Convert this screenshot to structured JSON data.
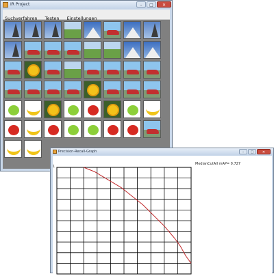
{
  "main_window": {
    "title": "IR Project",
    "controls": {
      "minimize": "–",
      "maximize": "□",
      "close": "✕"
    },
    "menu": [
      "Suchverfahren",
      "Testen",
      "Einstellungen"
    ],
    "thumbnails": [
      "eiffel",
      "eiffel",
      "eiffel",
      "field",
      "mountain",
      "car",
      "mountain",
      "eiffel",
      "eiffel",
      "car",
      "car",
      "car",
      "field",
      "field",
      "mountain",
      "mountain",
      "car",
      "flower",
      "car",
      "field",
      "car",
      "car",
      "car",
      "car",
      "car",
      "car",
      "car",
      "car",
      "flower",
      "car",
      "car",
      "car",
      "apple-green",
      "banana",
      "flower",
      "apple-green",
      "apple-red",
      "flower",
      "apple-green",
      "banana",
      "apple-red",
      "banana",
      "apple-red",
      "apple-green",
      "apple-green",
      "apple-red",
      "apple-red",
      "car",
      "banana",
      "banana"
    ]
  },
  "graph_window": {
    "title": "Precision-Recall-Graph",
    "controls": {
      "minimize": "–",
      "maximize": "□",
      "close": "✕"
    },
    "map_label": "MedianCutAll mAP= 0.727",
    "y_tick": "1"
  },
  "chart_data": {
    "type": "line",
    "xlabel": "",
    "ylabel": "",
    "xlim": [
      0,
      1
    ],
    "ylim": [
      0,
      1
    ],
    "grid": true,
    "x": [
      0.0,
      0.05,
      0.1,
      0.15,
      0.2,
      0.25,
      0.3,
      0.35,
      0.4,
      0.45,
      0.5,
      0.55,
      0.6,
      0.65,
      0.7,
      0.75,
      0.8,
      0.85,
      0.9,
      0.95,
      1.0
    ],
    "series": [
      {
        "values": [
          1.0,
          0.98,
          0.96,
          0.93,
          0.9,
          0.87,
          0.84,
          0.81,
          0.77,
          0.73,
          0.69,
          0.65,
          0.6,
          0.55,
          0.5,
          0.45,
          0.39,
          0.33,
          0.26,
          0.17,
          0.1
        ],
        "color": "#c0282a"
      }
    ],
    "start_x": 0.2
  }
}
